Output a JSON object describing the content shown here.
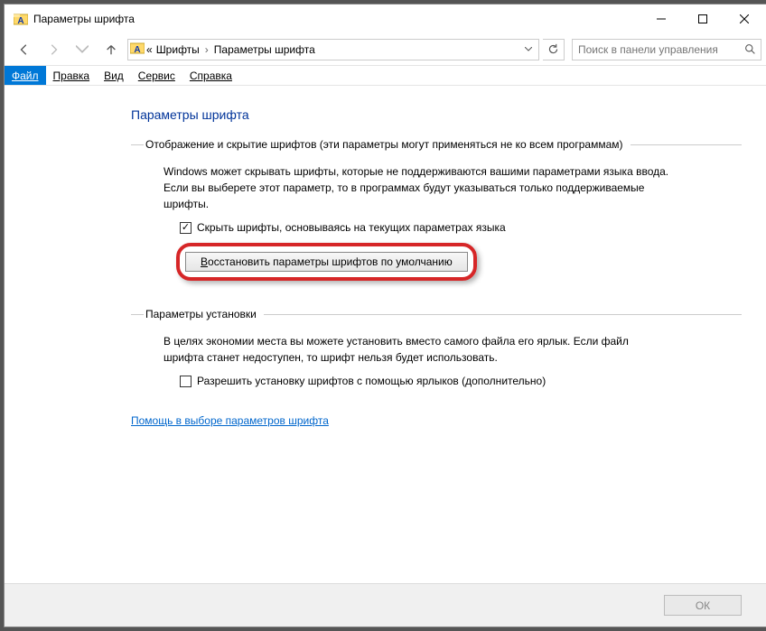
{
  "window": {
    "title": "Параметры шрифта"
  },
  "breadcrumb": {
    "prefix": "«",
    "seg1": "Шрифты",
    "seg2": "Параметры шрифта"
  },
  "search": {
    "placeholder": "Поиск в панели управления"
  },
  "menu": {
    "file": "Файл",
    "edit": "Правка",
    "view": "Вид",
    "tools": "Сервис",
    "help": "Справка"
  },
  "page": {
    "heading": "Параметры шрифта",
    "section1_title": "Отображение и скрытие шрифтов (эти параметры могут применяться не ко всем программам)",
    "section1_desc": "Windows может скрывать шрифты, которые не поддерживаются вашими параметрами языка ввода. Если вы выберете этот параметр, то в программах будут указываться только поддерживаемые шрифты.",
    "chk_hide_label": "Скрыть шрифты, основываясь на текущих параметрах языка",
    "restore_letter": "В",
    "restore_rest": "осстановить параметры шрифтов по умолчанию",
    "section2_title": "Параметры установки",
    "section2_desc": "В целях экономии места вы можете установить вместо самого файла его ярлык. Если файл шрифта станет недоступен, то шрифт нельзя будет использовать.",
    "chk_shortcut_label": "Разрешить установку шрифтов с помощью ярлыков (дополнительно)",
    "help_link": "Помощь в выборе параметров шрифта"
  },
  "footer": {
    "ok": "ОК"
  }
}
